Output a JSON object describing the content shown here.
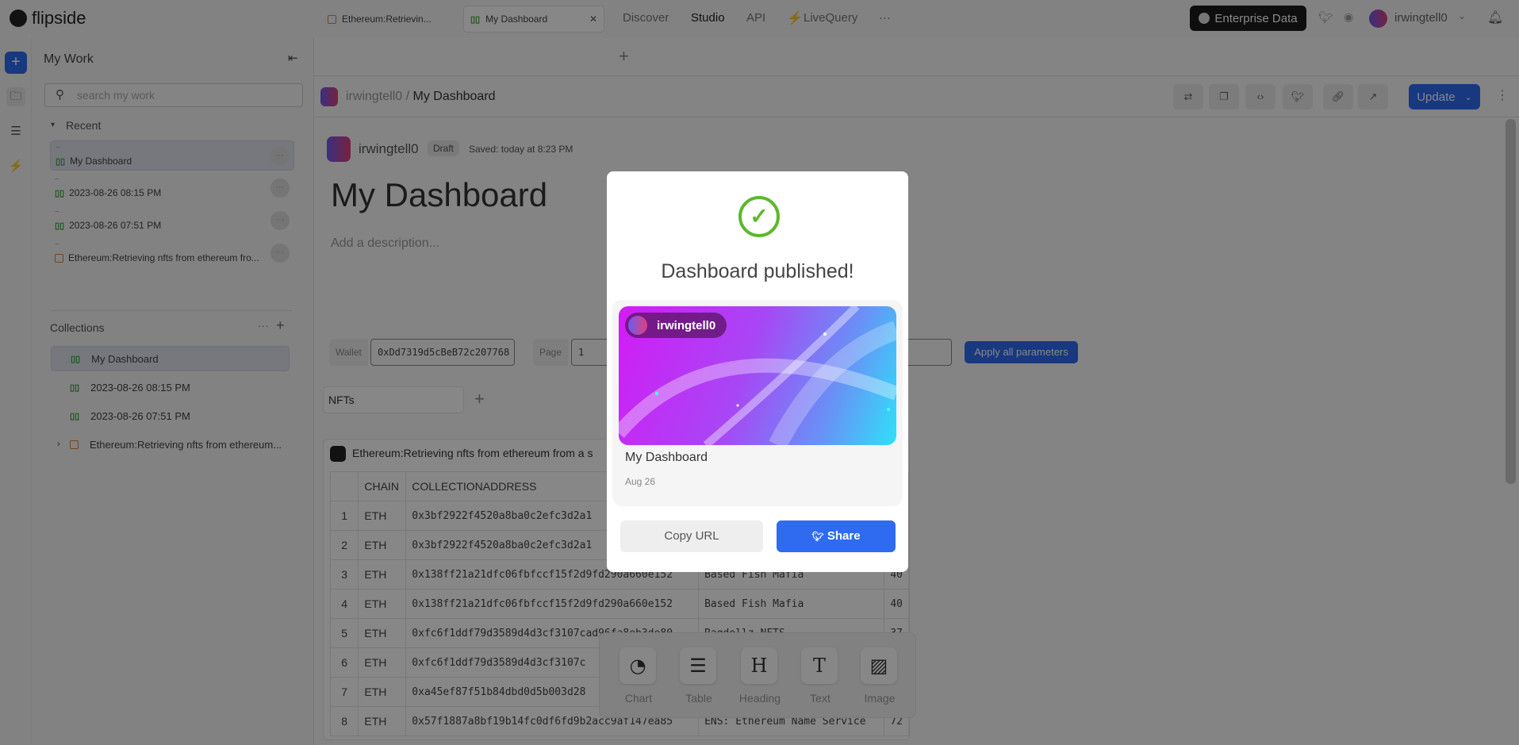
{
  "app": {
    "name": "flipside"
  },
  "nav": {
    "items": [
      "Discover",
      "Studio",
      "API",
      "LiveQuery"
    ],
    "active": "Studio",
    "more": "···"
  },
  "header": {
    "enterprise": "Enterprise Data",
    "user": "irwingtell0"
  },
  "sidebar": {
    "title": "My Work",
    "search_placeholder": "search my work",
    "recent_label": "Recent",
    "recent": [
      {
        "folder": "~",
        "name": "My Dashboard",
        "type": "dashboard"
      },
      {
        "folder": "~",
        "name": "2023-08-26 08:15 PM",
        "type": "dashboard"
      },
      {
        "folder": "~",
        "name": "2023-08-26 07:51 PM",
        "type": "dashboard"
      },
      {
        "folder": "~",
        "name": "Ethereum:Retrieving nfts from ethereum fro...",
        "type": "query"
      }
    ],
    "collections_label": "Collections",
    "collections": [
      "My Dashboard",
      "2023-08-26 08:15 PM",
      "2023-08-26 07:51 PM",
      "Ethereum:Retrieving nfts from ethereum..."
    ]
  },
  "tabs": [
    {
      "label": "Ethereum:Retrievin..."
    },
    {
      "label": "My Dashboard"
    }
  ],
  "breadcrumb": {
    "user": "irwingtell0",
    "separator": "/",
    "page": "My Dashboard"
  },
  "actions": {
    "update": "Update"
  },
  "dashboard": {
    "author": "irwingtell0",
    "status": "Draft",
    "saved": "Saved: today at 8:23 PM",
    "title": "My Dashboard",
    "description_placeholder": "Add a description...",
    "params": [
      {
        "label": "Wallet",
        "value": "0xDd7319d5cBeB72c207768"
      },
      {
        "label": "Page",
        "value": "1"
      }
    ],
    "apply": "Apply all parameters",
    "tab": "NFTs"
  },
  "table": {
    "title": "Ethereum:Retrieving nfts from ethereum from a s",
    "headers": [
      "",
      "CHAIN",
      "COLLECTIONADDRESS"
    ],
    "rows": [
      [
        "1",
        "ETH",
        "0x3bf2922f4520a8ba0c2efc3d2a1",
        "",
        ""
      ],
      [
        "2",
        "ETH",
        "0x3bf2922f4520a8ba0c2efc3d2a1",
        "",
        ""
      ],
      [
        "3",
        "ETH",
        "0x138ff21a21dfc06fbfccf15f2d9fd290a660e152",
        "Based Fish Mafia",
        "40"
      ],
      [
        "4",
        "ETH",
        "0x138ff21a21dfc06fbfccf15f2d9fd290a660e152",
        "Based Fish Mafia",
        "40"
      ],
      [
        "5",
        "ETH",
        "0xfc6f1ddf79d3589d4d3cf3107cad96fa8eb3de80",
        "Ragdollz NFTS",
        "37"
      ],
      [
        "6",
        "ETH",
        "0xfc6f1ddf79d3589d4d3cf3107c",
        "",
        ""
      ],
      [
        "7",
        "ETH",
        "0xa45ef87f51b84dbd0d5b003d28",
        "",
        ""
      ],
      [
        "8",
        "ETH",
        "0x57f1887a8bf19b14fc0df6fd9b2acc9af147ea85",
        "ENS: Ethereum Name Service",
        "72"
      ]
    ]
  },
  "toolbar": [
    "Chart",
    "Table",
    "Heading",
    "Text",
    "Image"
  ],
  "modal": {
    "title": "Dashboard published!",
    "user": "irwingtell0",
    "card_title": "My Dashboard",
    "card_date": "Aug 26",
    "copy": "Copy URL",
    "share": "Share"
  },
  "colors": {
    "accent": "#2f6bf0",
    "success": "#5cb82e"
  }
}
